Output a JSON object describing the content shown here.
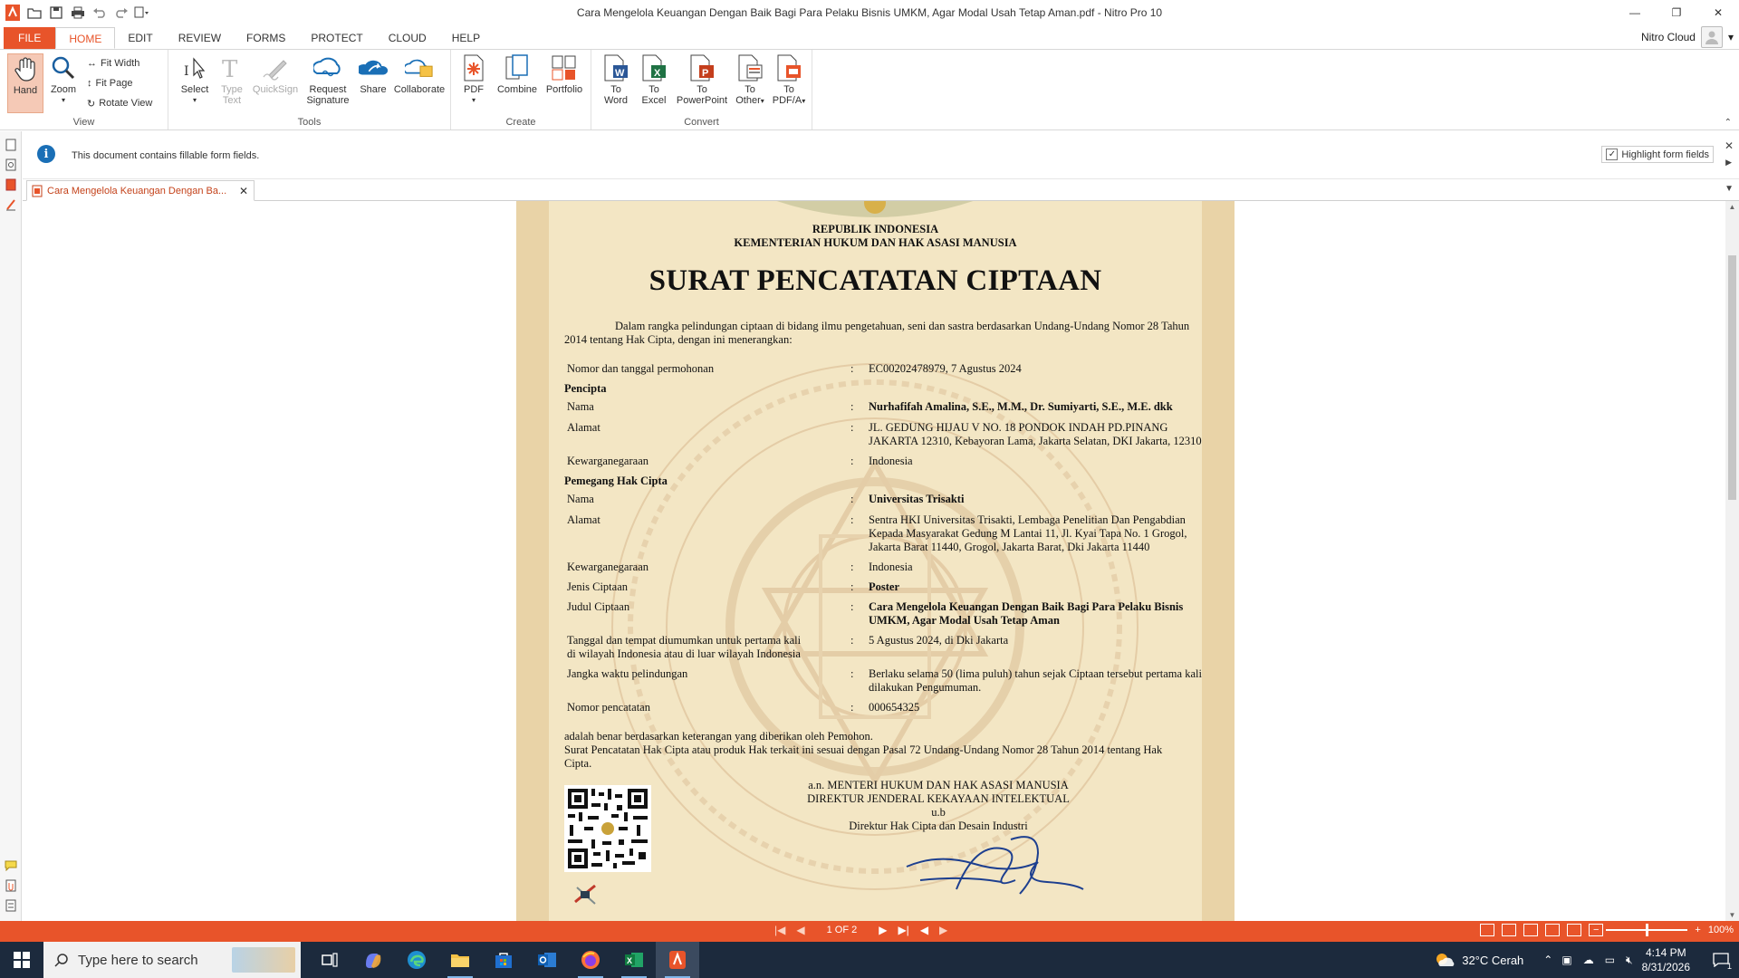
{
  "window": {
    "title": "Cara Mengelola Keuangan Dengan Baik Bagi Para Pelaku Bisnis UMKM, Agar Modal Usah Tetap Aman.pdf - Nitro Pro 10",
    "controls": {
      "minimize": "—",
      "restore": "❐",
      "close": "✕"
    }
  },
  "menu": {
    "tabs": [
      "FILE",
      "HOME",
      "EDIT",
      "REVIEW",
      "FORMS",
      "PROTECT",
      "CLOUD",
      "HELP"
    ],
    "active_tab": "HOME",
    "account_label": "Nitro Cloud"
  },
  "ribbon": {
    "view": {
      "label": "View",
      "hand": "Hand",
      "zoom": "Zoom",
      "fit_width": "Fit Width",
      "fit_page": "Fit Page",
      "rotate_view": "Rotate View"
    },
    "tools": {
      "label": "Tools",
      "select": "Select",
      "type_text_1": "Type",
      "type_text_2": "Text",
      "quicksign": "QuickSign",
      "request_signature_1": "Request",
      "request_signature_2": "Signature",
      "share": "Share",
      "collaborate": "Collaborate"
    },
    "create": {
      "label": "Create",
      "pdf": "PDF",
      "combine": "Combine",
      "portfolio": "Portfolio"
    },
    "convert": {
      "label": "Convert",
      "to": "To",
      "word": "Word",
      "excel": "Excel",
      "powerpoint": "PowerPoint",
      "other": "Other",
      "pdfa": "PDF/A"
    }
  },
  "infobar": {
    "message": "This document contains fillable form fields.",
    "highlight_label": "Highlight form fields",
    "highlight_checked": true
  },
  "doc_tab": {
    "label": "Cara Mengelola Keuangan Dengan Ba..."
  },
  "certificate": {
    "header1": "REPUBLIK INDONESIA",
    "header2": "KEMENTERIAN HUKUM DAN HAK ASASI MANUSIA",
    "title": "SURAT PENCATATAN CIPTAAN",
    "intro_1": "Dalam rangka pelindungan ciptaan di bidang ilmu pengetahuan, seni dan sastra berdasarkan Undang-Undang Nomor 28 Tahun",
    "intro_2": "2014 tentang Hak Cipta, dengan ini menerangkan:",
    "nomor_label": "Nomor dan tanggal permohonan",
    "nomor_value": "EC00202478979, 7 Agustus 2024",
    "pencipta_heading": "Pencipta",
    "nama_label": "Nama",
    "pencipta_nama": "Nurhafifah Amalina, S.E., M.M., Dr. Sumiyarti, S.E., M.E. dkk",
    "alamat_label": "Alamat",
    "pencipta_alamat_1": "JL. GEDUNG HIJAU V NO. 18 PONDOK INDAH PD.PINANG",
    "pencipta_alamat_2": "JAKARTA 12310, Kebayoran Lama, Jakarta Selatan, DKI Jakarta, 12310",
    "kewarganegaraan_label": "Kewarganegaraan",
    "pencipta_kewarganegaraan": "Indonesia",
    "pemegang_heading": "Pemegang Hak Cipta",
    "pemegang_nama": "Universitas Trisakti",
    "pemegang_alamat_1": "Sentra HKI Universitas Trisakti, Lembaga Penelitian Dan Pengabdian",
    "pemegang_alamat_2": "Kepada Masyarakat Gedung M Lantai 11, Jl. Kyai Tapa No. 1 Grogol,",
    "pemegang_alamat_3": "Jakarta Barat 11440, Grogol, Jakarta Barat, Dki Jakarta 11440",
    "pemegang_kewarganegaraan": "Indonesia",
    "jenis_label": "Jenis Ciptaan",
    "jenis_value": "Poster",
    "judul_label": "Judul Ciptaan",
    "judul_value_1": "Cara Mengelola Keuangan Dengan Baik Bagi Para Pelaku Bisnis",
    "judul_value_2": "UMKM, Agar Modal Usah Tetap Aman",
    "tanggal_label_1": "Tanggal dan tempat diumumkan untuk pertama kali",
    "tanggal_label_2": "di wilayah Indonesia atau di luar wilayah Indonesia",
    "tanggal_value": "5 Agustus 2024, di Dki Jakarta",
    "jangka_label": "Jangka waktu pelindungan",
    "jangka_value_1": "Berlaku selama 50 (lima puluh) tahun sejak Ciptaan tersebut pertama kali",
    "jangka_value_2": "dilakukan Pengumuman.",
    "nomor_pencatatan_label": "Nomor pencatatan",
    "nomor_pencatatan_value": "000654325",
    "closing_1": "adalah benar berdasarkan keterangan yang diberikan oleh Pemohon.",
    "closing_2": "Surat Pencatatan Hak Cipta atau produk Hak terkait ini sesuai dengan Pasal 72 Undang-Undang Nomor 28 Tahun 2014 tentang Hak",
    "closing_3": "Cipta.",
    "sign_1": "a.n. MENTERI HUKUM DAN HAK ASASI MANUSIA",
    "sign_2": "DIREKTUR JENDERAL KEKAYAAN INTELEKTUAL",
    "sign_3": "u.b",
    "sign_4": "Direktur Hak Cipta dan Desain Industri",
    "colon": ":"
  },
  "statusbar": {
    "page_indicator": "1 OF 2",
    "zoom_level": "100%",
    "zoom_minus": "−",
    "zoom_plus": "+"
  },
  "taskbar": {
    "search_placeholder": "Type here to search",
    "weather": "32°C  Cerah",
    "time": "4:14 PM",
    "date": "8/31/2026",
    "notification_count": "1"
  },
  "colors": {
    "accent": "#e8542a",
    "taskbar": "#1c2a3d",
    "certificate_bg": "#f3e6c4",
    "certificate_border": "#e9d3a7"
  },
  "icons": {
    "qat": [
      "nitro-logo-icon",
      "open-icon",
      "save-icon",
      "print-icon",
      "undo-icon",
      "redo-icon",
      "customize-icon"
    ],
    "leftbar": [
      "pages-icon",
      "bookmarks-icon",
      "attachments-icon",
      "signatures-icon",
      "comments-icon",
      "attach-panel-icon",
      "fields-icon"
    ],
    "taskbar_apps": [
      "task-view-icon",
      "copilot-icon",
      "edge-icon",
      "file-explorer-icon",
      "store-icon",
      "outlook-icon",
      "firefox-icon",
      "excel-icon",
      "nitro-icon"
    ]
  }
}
